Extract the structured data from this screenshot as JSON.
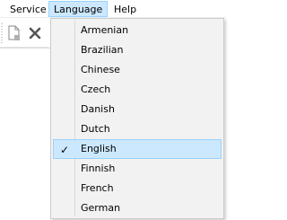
{
  "menubar": {
    "items": [
      {
        "label": "Service"
      },
      {
        "label": "Language"
      },
      {
        "label": "Help"
      }
    ]
  },
  "toolbar": {
    "buttons": [
      {
        "icon": "new-document-icon"
      },
      {
        "icon": "delete-x-icon"
      }
    ]
  },
  "language_menu": {
    "items": [
      {
        "label": "Armenian"
      },
      {
        "label": "Brazilian"
      },
      {
        "label": "Chinese"
      },
      {
        "label": "Czech"
      },
      {
        "label": "Danish"
      },
      {
        "label": "Dutch"
      },
      {
        "label": "English",
        "checked": true
      },
      {
        "label": "Finnish"
      },
      {
        "label": "French"
      },
      {
        "label": "German"
      }
    ],
    "check_glyph": "✓",
    "highlight_color": "#cce8ff",
    "highlight_border": "#99d1ff"
  }
}
